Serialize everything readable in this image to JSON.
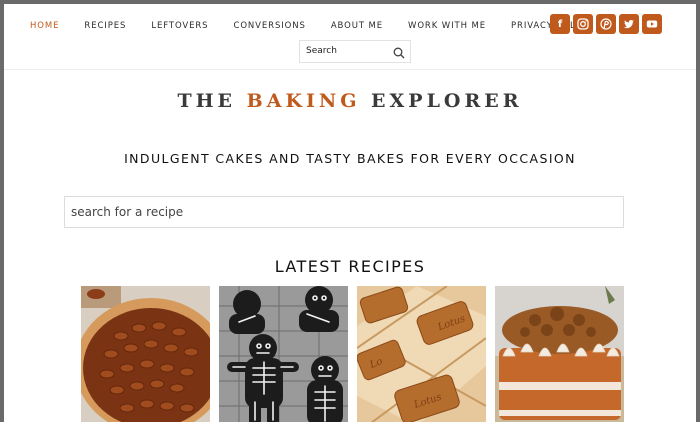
{
  "nav": {
    "items": [
      {
        "label": "HOME",
        "active": true
      },
      {
        "label": "RECIPES",
        "active": false
      },
      {
        "label": "LEFTOVERS",
        "active": false
      },
      {
        "label": "CONVERSIONS",
        "active": false
      },
      {
        "label": "ABOUT ME",
        "active": false
      },
      {
        "label": "WORK WITH ME",
        "active": false
      },
      {
        "label": "PRIVACY POLICY",
        "active": false
      }
    ],
    "social": [
      {
        "icon": "facebook-icon",
        "glyph": "f"
      },
      {
        "icon": "instagram-icon",
        "glyph": "◎"
      },
      {
        "icon": "pinterest-icon",
        "glyph": "P"
      },
      {
        "icon": "twitter-icon",
        "glyph": "t"
      },
      {
        "icon": "youtube-icon",
        "glyph": "▶"
      }
    ],
    "search_placeholder": "Search"
  },
  "logo": {
    "part1": "THE ",
    "accent": "BAKING",
    "part2": " EXPLORER"
  },
  "tagline": "INDULGENT CAKES AND TASTY BAKES FOR EVERY OCCASION",
  "recipe_search_placeholder": "search for a recipe",
  "latest_heading": "LATEST RECIPES",
  "recipes": [
    {
      "image": "pecan-pie-image"
    },
    {
      "image": "gingerbread-skeleton-cookies-image"
    },
    {
      "image": "lotus-biscoff-bars-image"
    },
    {
      "image": "frosted-layer-cake-image"
    }
  ],
  "colors": {
    "accent": "#c05a1c",
    "text": "#2b2b2b",
    "background": "#ffffff",
    "frame": "#6a6a6a"
  }
}
